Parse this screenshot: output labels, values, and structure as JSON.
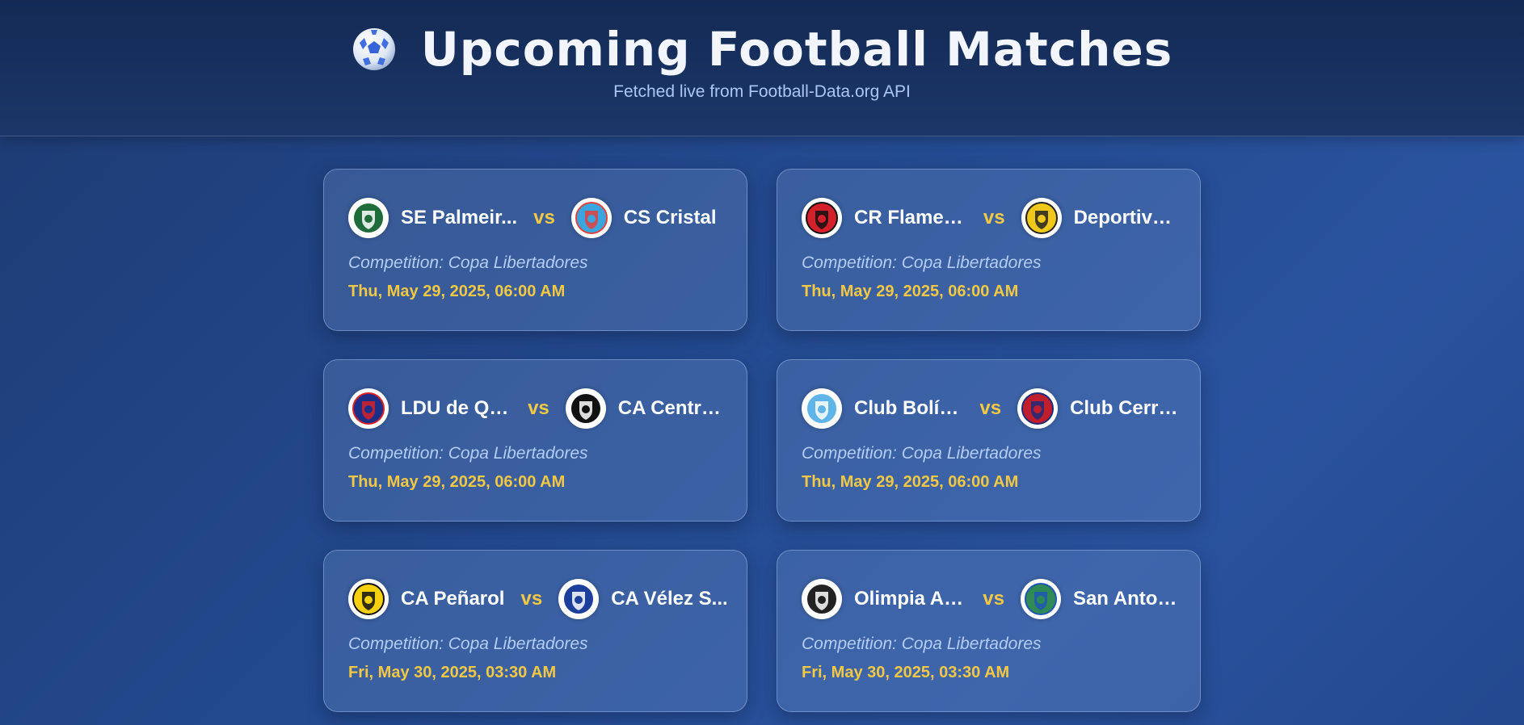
{
  "header": {
    "title": "Upcoming Football Matches",
    "subtitle": "Fetched live from Football-Data.org API",
    "icon": "soccer-ball-icon"
  },
  "matches": [
    {
      "home": "SE Palmeir...",
      "away": "CS Cristal",
      "vs": "vs",
      "competition": "Competition: Copa Libertadores",
      "date": "Thu, May 29, 2025, 06:00 AM",
      "home_colors": [
        "#1f6b3a",
        "#ffffff"
      ],
      "away_colors": [
        "#3aa6e0",
        "#e2413b"
      ]
    },
    {
      "home": "CR Flamen...",
      "away": "Deportivo ...",
      "vs": "vs",
      "competition": "Competition: Copa Libertadores",
      "date": "Thu, May 29, 2025, 06:00 AM",
      "home_colors": [
        "#d3202a",
        "#111111"
      ],
      "away_colors": [
        "#f0c81a",
        "#222222"
      ]
    },
    {
      "home": "LDU de Qu...",
      "away": "CA Central...",
      "vs": "vs",
      "competition": "Competition: Copa Libertadores",
      "date": "Thu, May 29, 2025, 06:00 AM",
      "home_colors": [
        "#1c2f86",
        "#d6202a"
      ],
      "away_colors": [
        "#111111",
        "#ffffff"
      ]
    },
    {
      "home": "Club Bolívar",
      "away": "Club Cerro...",
      "vs": "vs",
      "competition": "Competition: Copa Libertadores",
      "date": "Thu, May 29, 2025, 06:00 AM",
      "home_colors": [
        "#5fb5e8",
        "#ffffff"
      ],
      "away_colors": [
        "#c01e2d",
        "#1d2a78"
      ]
    },
    {
      "home": "CA Peñarol",
      "away": "CA Vélez S...",
      "vs": "vs",
      "competition": "Competition: Copa Libertadores",
      "date": "Fri, May 30, 2025, 03:30 AM",
      "home_colors": [
        "#f6d20e",
        "#111111"
      ],
      "away_colors": [
        "#1c3f9c",
        "#ffffff"
      ]
    },
    {
      "home": "Olimpia As...",
      "away": "San Anton...",
      "vs": "vs",
      "competition": "Competition: Copa Libertadores",
      "date": "Fri, May 30, 2025, 03:30 AM",
      "home_colors": [
        "#222222",
        "#ffffff"
      ],
      "away_colors": [
        "#2f8a56",
        "#1f57b5"
      ]
    }
  ]
}
